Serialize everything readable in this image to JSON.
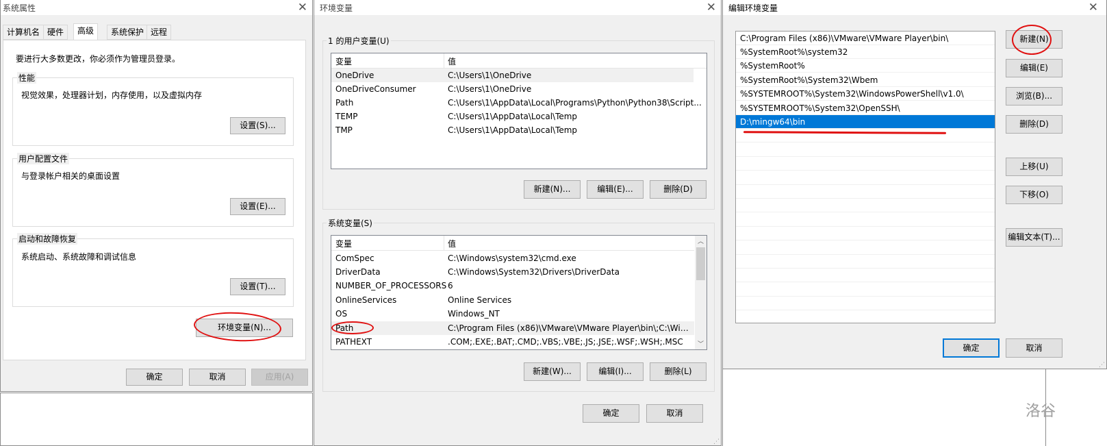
{
  "sysprops": {
    "title": "系统属性",
    "tabs": [
      "计算机名",
      "硬件",
      "高级",
      "系统保护",
      "远程"
    ],
    "notice": "要进行大多数更改，你必须作为管理员登录。",
    "perf": {
      "label": "性能",
      "desc": "视觉效果，处理器计划，内存使用，以及虚拟内存",
      "button": "设置(S)..."
    },
    "profile": {
      "label": "用户配置文件",
      "desc": "与登录帐户相关的桌面设置",
      "button": "设置(E)..."
    },
    "startup": {
      "label": "启动和故障恢复",
      "desc": "系统启动、系统故障和调试信息",
      "button": "设置(T)..."
    },
    "envvars_button": "环境变量(N)...",
    "ok": "确定",
    "cancel": "取消",
    "apply": "应用(A)"
  },
  "envdlg": {
    "title": "环境变量",
    "user_group": "1 的用户变量(U)",
    "col_var": "变量",
    "col_val": "值",
    "user_vars": [
      {
        "name": "OneDrive",
        "value": "C:\\Users\\1\\OneDrive"
      },
      {
        "name": "OneDriveConsumer",
        "value": "C:\\Users\\1\\OneDrive"
      },
      {
        "name": "Path",
        "value": "C:\\Users\\1\\AppData\\Local\\Programs\\Python\\Python38\\Script..."
      },
      {
        "name": "TEMP",
        "value": "C:\\Users\\1\\AppData\\Local\\Temp"
      },
      {
        "name": "TMP",
        "value": "C:\\Users\\1\\AppData\\Local\\Temp"
      }
    ],
    "user_new": "新建(N)...",
    "user_edit": "编辑(E)...",
    "user_delete": "删除(D)",
    "sys_group": "系统变量(S)",
    "sys_vars": [
      {
        "name": "ComSpec",
        "value": "C:\\Windows\\system32\\cmd.exe"
      },
      {
        "name": "DriverData",
        "value": "C:\\Windows\\System32\\Drivers\\DriverData"
      },
      {
        "name": "NUMBER_OF_PROCESSORS",
        "value": "6"
      },
      {
        "name": "OnlineServices",
        "value": "Online Services"
      },
      {
        "name": "OS",
        "value": "Windows_NT"
      },
      {
        "name": "Path",
        "value": "C:\\Program Files (x86)\\VMware\\VMware Player\\bin\\;C:\\Wind..."
      },
      {
        "name": "PATHEXT",
        "value": ".COM;.EXE;.BAT;.CMD;.VBS;.VBE;.JS;.JSE;.WSF;.WSH;.MSC"
      }
    ],
    "sys_new": "新建(W)...",
    "sys_edit": "编辑(I)...",
    "sys_delete": "删除(L)",
    "ok": "确定",
    "cancel": "取消"
  },
  "editdlg": {
    "title": "编辑环境变量",
    "paths": [
      "C:\\Program Files (x86)\\VMware\\VMware Player\\bin\\",
      "%SystemRoot%\\system32",
      "%SystemRoot%",
      "%SystemRoot%\\System32\\Wbem",
      "%SYSTEMROOT%\\System32\\WindowsPowerShell\\v1.0\\",
      "%SYSTEMROOT%\\System32\\OpenSSH\\",
      "D:\\mingw64\\bin"
    ],
    "new": "新建(N)",
    "edit": "编辑(E)",
    "browse": "浏览(B)...",
    "delete": "删除(D)",
    "up": "上移(U)",
    "down": "下移(O)",
    "edit_text": "编辑文本(T)...",
    "ok": "确定",
    "cancel": "取消"
  },
  "watermark": "洛谷",
  "annotation_color": "#e01010",
  "selection_color": "#0078d7"
}
